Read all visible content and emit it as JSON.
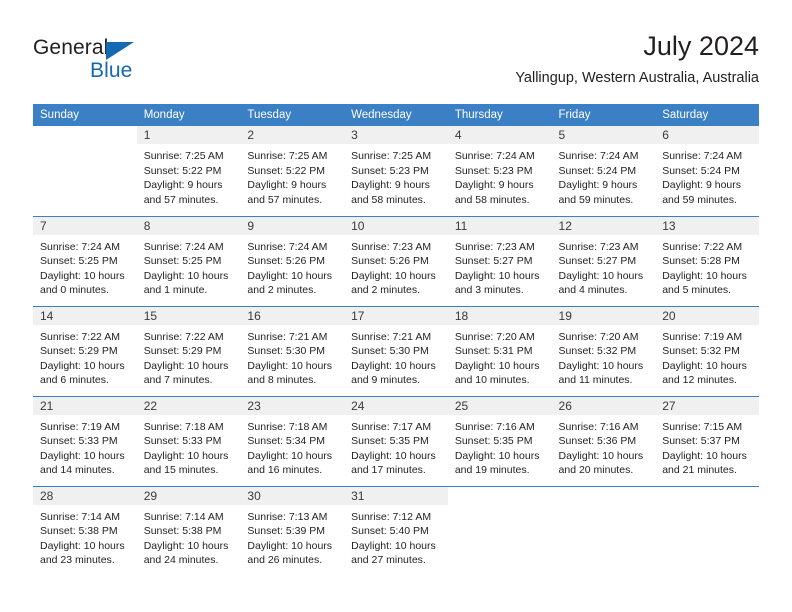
{
  "brand": {
    "name_top": "General",
    "name_bottom": "Blue",
    "accent_color": "#1569b0"
  },
  "header": {
    "month_title": "July 2024",
    "location": "Yallingup, Western Australia, Australia"
  },
  "calendar": {
    "header_color": "#3b7fc4",
    "daynum_band_color": "#f0f0f0",
    "weekday_headers": [
      "Sunday",
      "Monday",
      "Tuesday",
      "Wednesday",
      "Thursday",
      "Friday",
      "Saturday"
    ],
    "weeks": [
      [
        {
          "day": "",
          "lines": []
        },
        {
          "day": "1",
          "lines": [
            "Sunrise: 7:25 AM",
            "Sunset: 5:22 PM",
            "Daylight: 9 hours",
            "and 57 minutes."
          ]
        },
        {
          "day": "2",
          "lines": [
            "Sunrise: 7:25 AM",
            "Sunset: 5:22 PM",
            "Daylight: 9 hours",
            "and 57 minutes."
          ]
        },
        {
          "day": "3",
          "lines": [
            "Sunrise: 7:25 AM",
            "Sunset: 5:23 PM",
            "Daylight: 9 hours",
            "and 58 minutes."
          ]
        },
        {
          "day": "4",
          "lines": [
            "Sunrise: 7:24 AM",
            "Sunset: 5:23 PM",
            "Daylight: 9 hours",
            "and 58 minutes."
          ]
        },
        {
          "day": "5",
          "lines": [
            "Sunrise: 7:24 AM",
            "Sunset: 5:24 PM",
            "Daylight: 9 hours",
            "and 59 minutes."
          ]
        },
        {
          "day": "6",
          "lines": [
            "Sunrise: 7:24 AM",
            "Sunset: 5:24 PM",
            "Daylight: 9 hours",
            "and 59 minutes."
          ]
        }
      ],
      [
        {
          "day": "7",
          "lines": [
            "Sunrise: 7:24 AM",
            "Sunset: 5:25 PM",
            "Daylight: 10 hours",
            "and 0 minutes."
          ]
        },
        {
          "day": "8",
          "lines": [
            "Sunrise: 7:24 AM",
            "Sunset: 5:25 PM",
            "Daylight: 10 hours",
            "and 1 minute."
          ]
        },
        {
          "day": "9",
          "lines": [
            "Sunrise: 7:24 AM",
            "Sunset: 5:26 PM",
            "Daylight: 10 hours",
            "and 2 minutes."
          ]
        },
        {
          "day": "10",
          "lines": [
            "Sunrise: 7:23 AM",
            "Sunset: 5:26 PM",
            "Daylight: 10 hours",
            "and 2 minutes."
          ]
        },
        {
          "day": "11",
          "lines": [
            "Sunrise: 7:23 AM",
            "Sunset: 5:27 PM",
            "Daylight: 10 hours",
            "and 3 minutes."
          ]
        },
        {
          "day": "12",
          "lines": [
            "Sunrise: 7:23 AM",
            "Sunset: 5:27 PM",
            "Daylight: 10 hours",
            "and 4 minutes."
          ]
        },
        {
          "day": "13",
          "lines": [
            "Sunrise: 7:22 AM",
            "Sunset: 5:28 PM",
            "Daylight: 10 hours",
            "and 5 minutes."
          ]
        }
      ],
      [
        {
          "day": "14",
          "lines": [
            "Sunrise: 7:22 AM",
            "Sunset: 5:29 PM",
            "Daylight: 10 hours",
            "and 6 minutes."
          ]
        },
        {
          "day": "15",
          "lines": [
            "Sunrise: 7:22 AM",
            "Sunset: 5:29 PM",
            "Daylight: 10 hours",
            "and 7 minutes."
          ]
        },
        {
          "day": "16",
          "lines": [
            "Sunrise: 7:21 AM",
            "Sunset: 5:30 PM",
            "Daylight: 10 hours",
            "and 8 minutes."
          ]
        },
        {
          "day": "17",
          "lines": [
            "Sunrise: 7:21 AM",
            "Sunset: 5:30 PM",
            "Daylight: 10 hours",
            "and 9 minutes."
          ]
        },
        {
          "day": "18",
          "lines": [
            "Sunrise: 7:20 AM",
            "Sunset: 5:31 PM",
            "Daylight: 10 hours",
            "and 10 minutes."
          ]
        },
        {
          "day": "19",
          "lines": [
            "Sunrise: 7:20 AM",
            "Sunset: 5:32 PM",
            "Daylight: 10 hours",
            "and 11 minutes."
          ]
        },
        {
          "day": "20",
          "lines": [
            "Sunrise: 7:19 AM",
            "Sunset: 5:32 PM",
            "Daylight: 10 hours",
            "and 12 minutes."
          ]
        }
      ],
      [
        {
          "day": "21",
          "lines": [
            "Sunrise: 7:19 AM",
            "Sunset: 5:33 PM",
            "Daylight: 10 hours",
            "and 14 minutes."
          ]
        },
        {
          "day": "22",
          "lines": [
            "Sunrise: 7:18 AM",
            "Sunset: 5:33 PM",
            "Daylight: 10 hours",
            "and 15 minutes."
          ]
        },
        {
          "day": "23",
          "lines": [
            "Sunrise: 7:18 AM",
            "Sunset: 5:34 PM",
            "Daylight: 10 hours",
            "and 16 minutes."
          ]
        },
        {
          "day": "24",
          "lines": [
            "Sunrise: 7:17 AM",
            "Sunset: 5:35 PM",
            "Daylight: 10 hours",
            "and 17 minutes."
          ]
        },
        {
          "day": "25",
          "lines": [
            "Sunrise: 7:16 AM",
            "Sunset: 5:35 PM",
            "Daylight: 10 hours",
            "and 19 minutes."
          ]
        },
        {
          "day": "26",
          "lines": [
            "Sunrise: 7:16 AM",
            "Sunset: 5:36 PM",
            "Daylight: 10 hours",
            "and 20 minutes."
          ]
        },
        {
          "day": "27",
          "lines": [
            "Sunrise: 7:15 AM",
            "Sunset: 5:37 PM",
            "Daylight: 10 hours",
            "and 21 minutes."
          ]
        }
      ],
      [
        {
          "day": "28",
          "lines": [
            "Sunrise: 7:14 AM",
            "Sunset: 5:38 PM",
            "Daylight: 10 hours",
            "and 23 minutes."
          ]
        },
        {
          "day": "29",
          "lines": [
            "Sunrise: 7:14 AM",
            "Sunset: 5:38 PM",
            "Daylight: 10 hours",
            "and 24 minutes."
          ]
        },
        {
          "day": "30",
          "lines": [
            "Sunrise: 7:13 AM",
            "Sunset: 5:39 PM",
            "Daylight: 10 hours",
            "and 26 minutes."
          ]
        },
        {
          "day": "31",
          "lines": [
            "Sunrise: 7:12 AM",
            "Sunset: 5:40 PM",
            "Daylight: 10 hours",
            "and 27 minutes."
          ]
        },
        {
          "day": "",
          "lines": []
        },
        {
          "day": "",
          "lines": []
        },
        {
          "day": "",
          "lines": []
        }
      ]
    ]
  }
}
